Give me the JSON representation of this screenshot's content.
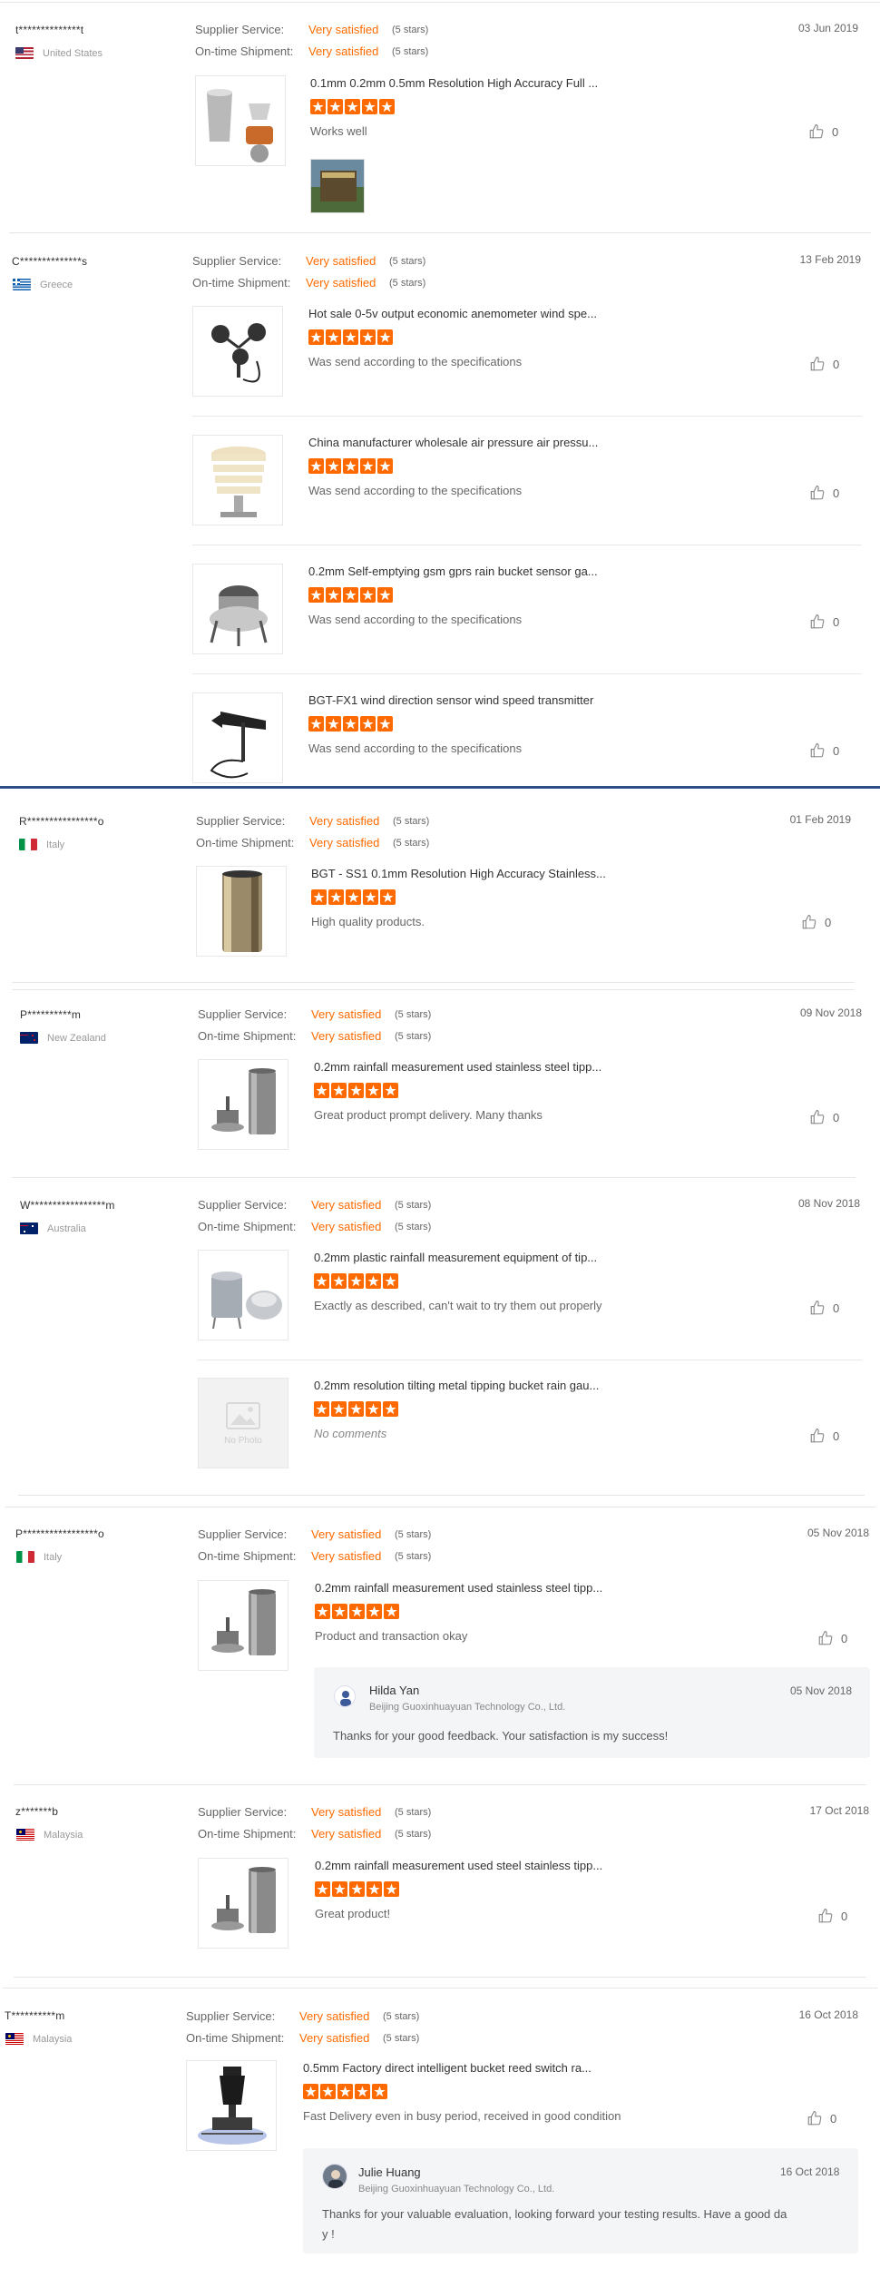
{
  "labels": {
    "supplier_service": "Supplier Service:",
    "ontime_shipment": "On-time Shipment:",
    "very_satisfied": "Very satisfied",
    "five_stars": "(5 stars)",
    "no_photo": "No Photo"
  },
  "reviews": [
    {
      "buyer": "t**************t",
      "country": "United States",
      "date": "03 Jun 2019",
      "items": [
        {
          "name": "0.1mm 0.2mm 0.5mm Resolution High Accuracy Full ...",
          "rating": 5,
          "comment": "Works well",
          "likes": "0"
        }
      ]
    },
    {
      "buyer": "C**************s",
      "country": "Greece",
      "date": "13 Feb 2019",
      "items": [
        {
          "name": "Hot sale 0-5v output economic anemometer wind spe...",
          "rating": 5,
          "comment": "Was send according to the specifications",
          "likes": "0"
        },
        {
          "name": "China manufacturer wholesale air pressure air pressu...",
          "rating": 5,
          "comment": "Was send according to the specifications",
          "likes": "0"
        },
        {
          "name": "0.2mm Self-emptying gsm gprs rain bucket sensor ga...",
          "rating": 5,
          "comment": "Was send according to the specifications",
          "likes": "0"
        },
        {
          "name": "BGT-FX1 wind direction sensor wind speed transmitter",
          "rating": 5,
          "comment": "Was send according to the specifications",
          "likes": "0"
        }
      ]
    },
    {
      "buyer": "R****************o",
      "country": "Italy",
      "date": "01 Feb 2019",
      "items": [
        {
          "name": "BGT - SS1 0.1mm Resolution High Accuracy Stainless...",
          "rating": 5,
          "comment": "High quality products.",
          "likes": "0"
        }
      ]
    },
    {
      "buyer": "P**********m",
      "country": "New Zealand",
      "date": "09 Nov 2018",
      "items": [
        {
          "name": "0.2mm rainfall measurement used stainless steel tipp...",
          "rating": 5,
          "comment": "Great product prompt delivery. Many thanks",
          "likes": "0"
        }
      ]
    },
    {
      "buyer": "W*****************m",
      "country": "Australia",
      "date": "08 Nov 2018",
      "items": [
        {
          "name": "0.2mm plastic rainfall measurement equipment of tip...",
          "rating": 5,
          "comment": "Exactly as described, can't wait to try them out properly",
          "likes": "0"
        },
        {
          "name": "0.2mm resolution tilting metal tipping bucket rain gau...",
          "rating": 5,
          "comment": "No comments",
          "likes": "0"
        }
      ]
    },
    {
      "buyer": "P*****************o",
      "country": "Italy",
      "date": "05 Nov 2018",
      "items": [
        {
          "name": "0.2mm rainfall measurement used stainless steel tipp...",
          "rating": 5,
          "comment": "Product and transaction okay",
          "likes": "0"
        }
      ],
      "reply": {
        "name": "Hilda Yan",
        "company": "Beijing Guoxinhuayuan Technology Co., Ltd.",
        "date": "05 Nov 2018",
        "text": "Thanks for your good feedback. Your satisfaction is my success!"
      }
    },
    {
      "buyer": "z*******b",
      "country": "Malaysia",
      "date": "17 Oct 2018",
      "items": [
        {
          "name": "0.2mm rainfall measurement used steel stainless tipp...",
          "rating": 5,
          "comment": "Great product!",
          "likes": "0"
        }
      ]
    },
    {
      "buyer": "T**********m",
      "country": "Malaysia",
      "date": "16 Oct 2018",
      "items": [
        {
          "name": "0.5mm Factory direct intelligent bucket reed switch ra...",
          "rating": 5,
          "comment": "Fast Delivery even in busy period, received in good condition",
          "likes": "0"
        }
      ],
      "reply": {
        "name": "Julie Huang",
        "company": "Beijing Guoxinhuayuan Technology Co., Ltd.",
        "date": "16 Oct 2018",
        "text": "Thanks for your valuable evaluation, looking forward your testing results. Have a good day !",
        "text_line1": "Thanks for your valuable evaluation, looking forward your testing results. Have a good da",
        "text_line2": "y !"
      }
    }
  ],
  "colors": {
    "accent": "#ff6a00",
    "divider": "#2d4f88"
  },
  "icons": {
    "like": "thumbs-up-icon",
    "star": "star-icon"
  }
}
